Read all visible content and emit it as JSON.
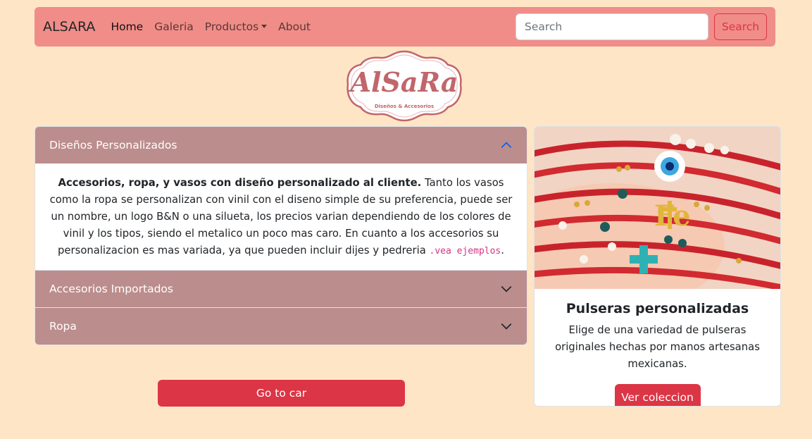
{
  "navbar": {
    "brand": "ALSARA",
    "links": [
      {
        "label": "Home",
        "active": true
      },
      {
        "label": "Galeria",
        "active": false
      },
      {
        "label": "Productos",
        "active": false,
        "dropdown": true
      },
      {
        "label": "About",
        "active": false
      }
    ],
    "search_placeholder": "Search",
    "search_button": "Search"
  },
  "logo": {
    "title": "AlSaRa",
    "subtitle": "Diseños & Accesorios"
  },
  "accordion": {
    "items": [
      {
        "title": "Diseños Personalizados",
        "expanded": true,
        "body_strong": "Accesorios, ropa, y vasos con diseño personalizado al cliente.",
        "body_text": " Tanto los vasos como la ropa se personalizan con vinil con el diseno simple de su preferencia, puede ser un nombre, un logo B&N o una silueta, los precios varian dependiendo de los colores de vinil y los tipos, siendo el metalico un poco mas caro. En cuanto a los accesorios su personalizacion es mas variada, ya que pueden incluir dijes y pedreria ",
        "body_code": ".vea ejemplos",
        "body_end": "."
      },
      {
        "title": "Accesorios Importados",
        "expanded": false
      },
      {
        "title": "Ropa",
        "expanded": false
      }
    ]
  },
  "go_button": "Go to car",
  "card": {
    "title": "Pulseras personalizadas",
    "text": "Elige de una variedad de pulseras originales hechas por manos artesanas mexicanas.",
    "button": "Ver coleccion",
    "image": "bracelets-photo"
  },
  "colors": {
    "background": "#fee5c6",
    "navbar": "#f08d88",
    "accordion_header": "#bc8d8d",
    "danger": "#dc3545"
  }
}
